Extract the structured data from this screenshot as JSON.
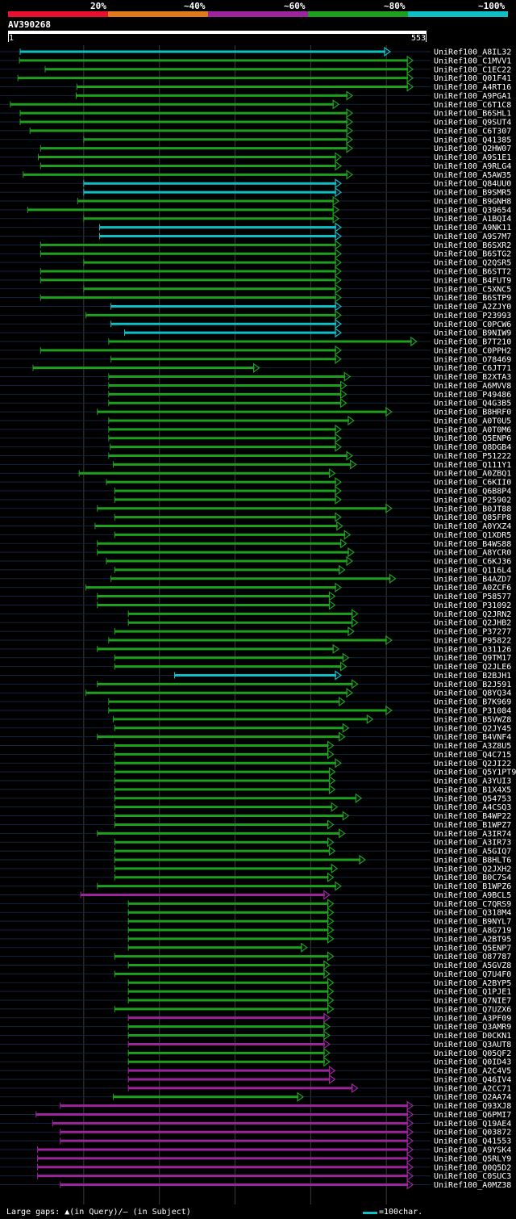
{
  "colors": {
    "bin_20": "#e8102c",
    "bin_40": "#e0781e",
    "bin_60": "#9c249c",
    "bin_80": "#1ea01e",
    "bin_100": "#0fbfc6",
    "background": "#000000",
    "row_line": "#14233f",
    "grid": "#3a3a3a",
    "gap_marker": "#ffff80"
  },
  "scale": {
    "labels": [
      "20%",
      "~40%",
      "~60%",
      "~80%",
      "~100%"
    ]
  },
  "query": {
    "name": "AV390268",
    "start": "1",
    "end": "553"
  },
  "footer": {
    "legend": "Large gaps: ▲(in Query)/– (in Subject)",
    "unit": "=100char."
  },
  "chart_data": {
    "type": "bar",
    "query_length": 553,
    "bins": [
      "20%",
      "~40%",
      "~60%",
      "~80%",
      "~100%"
    ],
    "hits": [
      {
        "name": "UniRef100_A8IL32",
        "start": 17,
        "end": 505,
        "bin": 4
      },
      {
        "name": "UniRef100_C1MVV1",
        "start": 16,
        "end": 535,
        "bin": 3
      },
      {
        "name": "UniRef100_C1EC22",
        "start": 50,
        "end": 535,
        "bin": 3
      },
      {
        "name": "UniRef100_Q01F41",
        "start": 14,
        "end": 535,
        "bin": 3
      },
      {
        "name": "UniRef100_A4RT16",
        "start": 92,
        "end": 535,
        "bin": 3
      },
      {
        "name": "UniRef100_A9PGA1",
        "start": 91,
        "end": 455,
        "bin": 3
      },
      {
        "name": "UniRef100_C6T1C8",
        "start": 4,
        "end": 437,
        "bin": 3
      },
      {
        "name": "UniRef100_B6SHL1",
        "start": 17,
        "end": 455,
        "bin": 3
      },
      {
        "name": "UniRef100_Q9SUT4",
        "start": 17,
        "end": 455,
        "bin": 3
      },
      {
        "name": "UniRef100_C6T307",
        "start": 30,
        "end": 455,
        "bin": 3
      },
      {
        "name": "UniRef100_Q41385",
        "start": 101,
        "end": 455,
        "bin": 3
      },
      {
        "name": "UniRef100_Q2HW07",
        "start": 44,
        "end": 455,
        "bin": 3
      },
      {
        "name": "UniRef100_A9S1E1",
        "start": 41,
        "end": 440,
        "bin": 3
      },
      {
        "name": "UniRef100_A9RLG4",
        "start": 44,
        "end": 440,
        "bin": 3
      },
      {
        "name": "UniRef100_A5AW35",
        "start": 21,
        "end": 455,
        "bin": 3
      },
      {
        "name": "UniRef100_Q84UU0",
        "start": 101,
        "end": 440,
        "bin": 4
      },
      {
        "name": "UniRef100_B9SMR5",
        "start": 101,
        "end": 440,
        "bin": 4
      },
      {
        "name": "UniRef100_B9GNH8",
        "start": 93,
        "end": 437,
        "bin": 3
      },
      {
        "name": "UniRef100_Q39654",
        "start": 27,
        "end": 437,
        "bin": 3
      },
      {
        "name": "UniRef100_A1BQI4",
        "start": 101,
        "end": 437,
        "bin": 3
      },
      {
        "name": "UniRef100_A9NK11",
        "start": 122,
        "end": 440,
        "bin": 4
      },
      {
        "name": "UniRef100_A9S7M7",
        "start": 122,
        "end": 440,
        "bin": 4
      },
      {
        "name": "UniRef100_B6SXR2",
        "start": 44,
        "end": 440,
        "bin": 3
      },
      {
        "name": "UniRef100_B6STG2",
        "start": 44,
        "end": 440,
        "bin": 3
      },
      {
        "name": "UniRef100_Q2QSR5",
        "start": 101,
        "end": 440,
        "bin": 3
      },
      {
        "name": "UniRef100_B6STT2",
        "start": 44,
        "end": 440,
        "bin": 3
      },
      {
        "name": "UniRef100_B4FUT9",
        "start": 44,
        "end": 440,
        "bin": 3
      },
      {
        "name": "UniRef100_C5XNC5",
        "start": 101,
        "end": 440,
        "bin": 3
      },
      {
        "name": "UniRef100_B6STP9",
        "start": 44,
        "end": 440,
        "bin": 3
      },
      {
        "name": "UniRef100_A2ZJY0",
        "start": 137,
        "end": 440,
        "bin": 4
      },
      {
        "name": "UniRef100_P23993",
        "start": 104,
        "end": 440,
        "bin": 3
      },
      {
        "name": "UniRef100_C0PCW6",
        "start": 137,
        "end": 440,
        "bin": 4
      },
      {
        "name": "UniRef100_B9NIW9",
        "start": 155,
        "end": 440,
        "bin": 4
      },
      {
        "name": "UniRef100_B7T210",
        "start": 134,
        "end": 540,
        "bin": 3
      },
      {
        "name": "UniRef100_C0PPH2",
        "start": 44,
        "end": 440,
        "bin": 3
      },
      {
        "name": "UniRef100_O78469",
        "start": 137,
        "end": 440,
        "bin": 3
      },
      {
        "name": "UniRef100_C6JT71",
        "start": 34,
        "end": 332,
        "bin": 3
      },
      {
        "name": "UniRef100_B2XTA3",
        "start": 134,
        "end": 452,
        "bin": 3
      },
      {
        "name": "UniRef100_A6MVV8",
        "start": 134,
        "end": 447,
        "bin": 3
      },
      {
        "name": "UniRef100_P49486",
        "start": 134,
        "end": 447,
        "bin": 3
      },
      {
        "name": "UniRef100_Q4G3B5",
        "start": 134,
        "end": 447,
        "bin": 3
      },
      {
        "name": "UniRef100_B8HRF0",
        "start": 119,
        "end": 507,
        "bin": 3
      },
      {
        "name": "UniRef100_A0T0U5",
        "start": 134,
        "end": 457,
        "bin": 3
      },
      {
        "name": "UniRef100_A0T0M6",
        "start": 134,
        "end": 440,
        "bin": 3
      },
      {
        "name": "UniRef100_Q5ENP6",
        "start": 134,
        "end": 440,
        "bin": 3
      },
      {
        "name": "UniRef100_Q8DGB4",
        "start": 136,
        "end": 440,
        "bin": 3
      },
      {
        "name": "UniRef100_P51222",
        "start": 134,
        "end": 455,
        "bin": 3
      },
      {
        "name": "UniRef100_Q111Y1",
        "start": 140,
        "end": 460,
        "bin": 3
      },
      {
        "name": "UniRef100_A0ZBQ1",
        "start": 95,
        "end": 432,
        "bin": 3
      },
      {
        "name": "UniRef100_C6KII0",
        "start": 131,
        "end": 440,
        "bin": 3
      },
      {
        "name": "UniRef100_Q6B8P4",
        "start": 142,
        "end": 440,
        "bin": 3
      },
      {
        "name": "UniRef100_P25902",
        "start": 142,
        "end": 440,
        "bin": 3
      },
      {
        "name": "UniRef100_B0JT88",
        "start": 119,
        "end": 507,
        "bin": 3
      },
      {
        "name": "UniRef100_Q85FP8",
        "start": 142,
        "end": 440,
        "bin": 3
      },
      {
        "name": "UniRef100_A0YXZ4",
        "start": 116,
        "end": 442,
        "bin": 3
      },
      {
        "name": "UniRef100_Q1XDR5",
        "start": 142,
        "end": 452,
        "bin": 3
      },
      {
        "name": "UniRef100_B4WS88",
        "start": 119,
        "end": 447,
        "bin": 3
      },
      {
        "name": "UniRef100_A8YCR0",
        "start": 119,
        "end": 457,
        "bin": 3
      },
      {
        "name": "UniRef100_C6KJ36",
        "start": 131,
        "end": 455,
        "bin": 3
      },
      {
        "name": "UniRef100_Q116L4",
        "start": 142,
        "end": 445,
        "bin": 3
      },
      {
        "name": "UniRef100_B4AZD7",
        "start": 137,
        "end": 512,
        "bin": 3
      },
      {
        "name": "UniRef100_A0ZCF6",
        "start": 104,
        "end": 440,
        "bin": 3
      },
      {
        "name": "UniRef100_P58577",
        "start": 119,
        "end": 432,
        "bin": 3
      },
      {
        "name": "UniRef100_P31092",
        "start": 119,
        "end": 432,
        "bin": 3
      },
      {
        "name": "UniRef100_Q2JRN2",
        "start": 160,
        "end": 462,
        "bin": 3
      },
      {
        "name": "UniRef100_Q2JHB2",
        "start": 160,
        "end": 462,
        "bin": 3
      },
      {
        "name": "UniRef100_P37277",
        "start": 142,
        "end": 457,
        "bin": 3
      },
      {
        "name": "UniRef100_P95822",
        "start": 134,
        "end": 507,
        "bin": 3
      },
      {
        "name": "UniRef100_O31126",
        "start": 119,
        "end": 437,
        "bin": 3
      },
      {
        "name": "UniRef100_Q9TM17",
        "start": 142,
        "end": 450,
        "bin": 3
      },
      {
        "name": "UniRef100_Q2JLE6",
        "start": 142,
        "end": 447,
        "bin": 3
      },
      {
        "name": "UniRef100_B2BJH1",
        "start": 221,
        "end": 440,
        "bin": 4
      },
      {
        "name": "UniRef100_B2J591",
        "start": 119,
        "end": 462,
        "bin": 3
      },
      {
        "name": "UniRef100_Q8YQ34",
        "start": 104,
        "end": 455,
        "bin": 3
      },
      {
        "name": "UniRef100_B7K969",
        "start": 134,
        "end": 445,
        "bin": 3
      },
      {
        "name": "UniRef100_P31084",
        "start": 134,
        "end": 507,
        "bin": 3
      },
      {
        "name": "UniRef100_B5VWZ8",
        "start": 140,
        "end": 482,
        "bin": 3
      },
      {
        "name": "UniRef100_Q2JY45",
        "start": 142,
        "end": 450,
        "bin": 3
      },
      {
        "name": "UniRef100_B4VNF4",
        "start": 119,
        "end": 445,
        "bin": 3
      },
      {
        "name": "UniRef100_A3Z8U5",
        "start": 142,
        "end": 430,
        "bin": 3
      },
      {
        "name": "UniRef100_Q4C715",
        "start": 142,
        "end": 430,
        "bin": 3
      },
      {
        "name": "UniRef100_Q2JI22",
        "start": 142,
        "end": 440,
        "bin": 3
      },
      {
        "name": "UniRef100_Q5Y1PT9",
        "start": 142,
        "end": 432,
        "bin": 3
      },
      {
        "name": "UniRef100_A3YUI3",
        "start": 142,
        "end": 432,
        "bin": 3
      },
      {
        "name": "UniRef100_B1X4X5",
        "start": 142,
        "end": 432,
        "bin": 3
      },
      {
        "name": "UniRef100_Q54753",
        "start": 142,
        "end": 467,
        "bin": 3
      },
      {
        "name": "UniRef100_A4CSQ3",
        "start": 142,
        "end": 435,
        "bin": 3
      },
      {
        "name": "UniRef100_B4WP22",
        "start": 142,
        "end": 450,
        "bin": 3
      },
      {
        "name": "UniRef100_B1WPZ7",
        "start": 142,
        "end": 430,
        "bin": 3
      },
      {
        "name": "UniRef100_A3IR74",
        "start": 119,
        "end": 445,
        "bin": 3
      },
      {
        "name": "UniRef100_A3IR73",
        "start": 142,
        "end": 430,
        "bin": 3
      },
      {
        "name": "UniRef100_A5GIQ7",
        "start": 142,
        "end": 432,
        "bin": 3
      },
      {
        "name": "UniRef100_B8HLT6",
        "start": 142,
        "end": 472,
        "bin": 3
      },
      {
        "name": "UniRef100_Q2JXH2",
        "start": 142,
        "end": 435,
        "bin": 3
      },
      {
        "name": "UniRef100_B0C7S4",
        "start": 142,
        "end": 430,
        "bin": 3
      },
      {
        "name": "UniRef100_B1WPZ6",
        "start": 119,
        "end": 440,
        "bin": 3
      },
      {
        "name": "UniRef100_A9BCL5",
        "start": 97,
        "end": 425,
        "bin": 2
      },
      {
        "name": "UniRef100_C7QRS9",
        "start": 160,
        "end": 430,
        "bin": 3
      },
      {
        "name": "UniRef100_Q318M4",
        "start": 160,
        "end": 430,
        "bin": 3
      },
      {
        "name": "UniRef100_B9NYL7",
        "start": 160,
        "end": 430,
        "bin": 3
      },
      {
        "name": "UniRef100_A8G719",
        "start": 160,
        "end": 430,
        "bin": 3
      },
      {
        "name": "UniRef100_A2BT95",
        "start": 160,
        "end": 430,
        "bin": 3
      },
      {
        "name": "UniRef100_Q5ENP7",
        "start": 160,
        "end": 395,
        "bin": 3
      },
      {
        "name": "UniRef100_O87787",
        "start": 142,
        "end": 430,
        "bin": 3
      },
      {
        "name": "UniRef100_A5GVZ8",
        "start": 160,
        "end": 425,
        "bin": 3
      },
      {
        "name": "UniRef100_Q7U4F0",
        "start": 142,
        "end": 425,
        "bin": 3
      },
      {
        "name": "UniRef100_A2BYP5",
        "start": 160,
        "end": 430,
        "bin": 3
      },
      {
        "name": "UniRef100_Q1PJE1",
        "start": 160,
        "end": 430,
        "bin": 3
      },
      {
        "name": "UniRef100_Q7NIE7",
        "start": 160,
        "end": 430,
        "bin": 3
      },
      {
        "name": "UniRef100_Q7UZX6",
        "start": 142,
        "end": 430,
        "bin": 3
      },
      {
        "name": "UniRef100_A3PF09",
        "start": 160,
        "end": 425,
        "bin": 2
      },
      {
        "name": "UniRef100_Q3AMR9",
        "start": 160,
        "end": 425,
        "bin": 3
      },
      {
        "name": "UniRef100_D0CKN1",
        "start": 160,
        "end": 425,
        "bin": 3
      },
      {
        "name": "UniRef100_Q3AUT8",
        "start": 160,
        "end": 425,
        "bin": 2
      },
      {
        "name": "UniRef100_Q05QF2",
        "start": 160,
        "end": 425,
        "bin": 3
      },
      {
        "name": "UniRef100_Q0ID43",
        "start": 160,
        "end": 425,
        "bin": 3
      },
      {
        "name": "UniRef100_A2C4V5",
        "start": 160,
        "end": 432,
        "bin": 2
      },
      {
        "name": "UniRef100_Q46IV4",
        "start": 160,
        "end": 432,
        "bin": 2
      },
      {
        "name": "UniRef100_A2CC71",
        "start": 160,
        "end": 462,
        "bin": 2
      },
      {
        "name": "UniRef100_Q2AA74",
        "start": 140,
        "end": 390,
        "bin": 3
      },
      {
        "name": "UniRef100_Q93XJ8",
        "start": 70,
        "end": 535,
        "bin": 2
      },
      {
        "name": "UniRef100_Q6PMI7",
        "start": 38,
        "end": 535,
        "bin": 2
      },
      {
        "name": "UniRef100_Q19AE4",
        "start": 60,
        "end": 535,
        "bin": 2
      },
      {
        "name": "UniRef100_Q03872",
        "start": 70,
        "end": 535,
        "bin": 2
      },
      {
        "name": "UniRef100_Q41553",
        "start": 70,
        "end": 535,
        "bin": 2
      },
      {
        "name": "UniRef100_A9YSK4",
        "start": 40,
        "end": 535,
        "bin": 2
      },
      {
        "name": "UniRef100_Q5RLY9",
        "start": 40,
        "end": 535,
        "bin": 2
      },
      {
        "name": "UniRef100_Q0Q5D2",
        "start": 40,
        "end": 535,
        "bin": 2
      },
      {
        "name": "UniRef100_C0SUC3",
        "start": 40,
        "end": 535,
        "bin": 2
      },
      {
        "name": "UniRef100_A0MZ38",
        "start": 70,
        "end": 535,
        "bin": 2
      }
    ]
  }
}
